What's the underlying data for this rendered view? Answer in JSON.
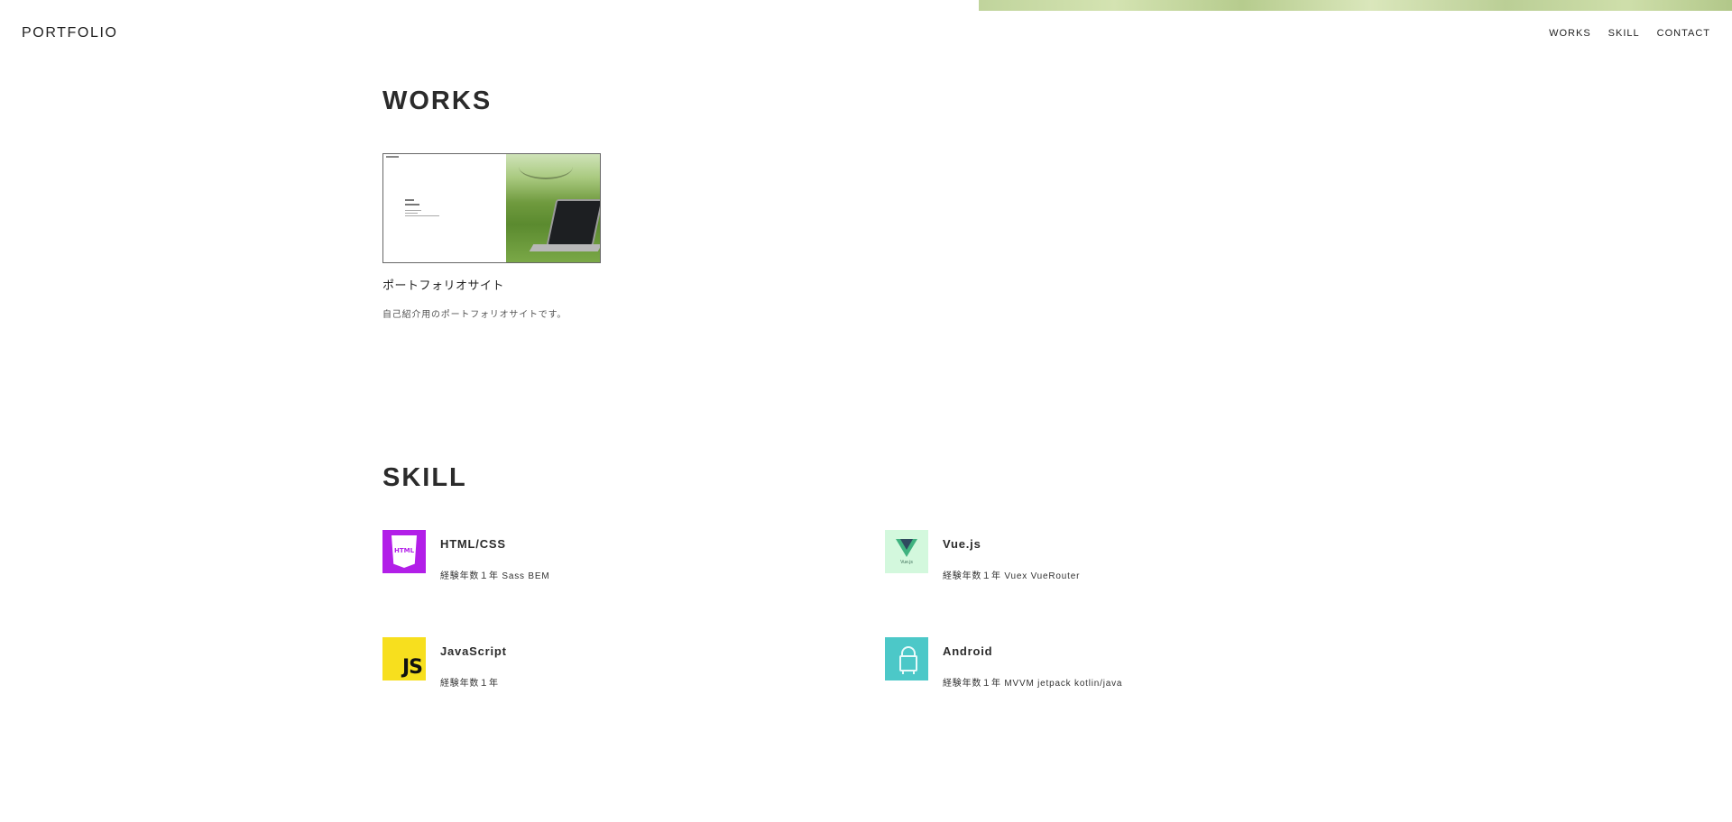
{
  "header": {
    "logo": "PORTFOLIO",
    "nav": [
      "WORKS",
      "SKILL",
      "CONTACT"
    ]
  },
  "works": {
    "title": "WORKS",
    "items": [
      {
        "title": "ポートフォリオサイト",
        "description": "自己紹介用のポートフォリオサイトです。"
      }
    ]
  },
  "skill": {
    "title": "SKILL",
    "items": [
      {
        "name": "HTML/CSS",
        "detail": "経験年数１年 Sass BEM",
        "icon": "html5-icon",
        "icon_color": "#b21fe8",
        "icon_text": "HTML"
      },
      {
        "name": "Vue.js",
        "detail": "経験年数１年 Vuex VueRouter",
        "icon": "vue-icon",
        "icon_color": "#d3f8dd",
        "icon_text": "Vue.js"
      },
      {
        "name": "JavaScript",
        "detail": "経験年数１年",
        "icon": "javascript-icon",
        "icon_color": "#f7df1e",
        "icon_text": "JS"
      },
      {
        "name": "Android",
        "detail": "経験年数１年 MVVM jetpack kotlin/java",
        "icon": "android-icon",
        "icon_color": "#4cc8c8"
      }
    ]
  }
}
